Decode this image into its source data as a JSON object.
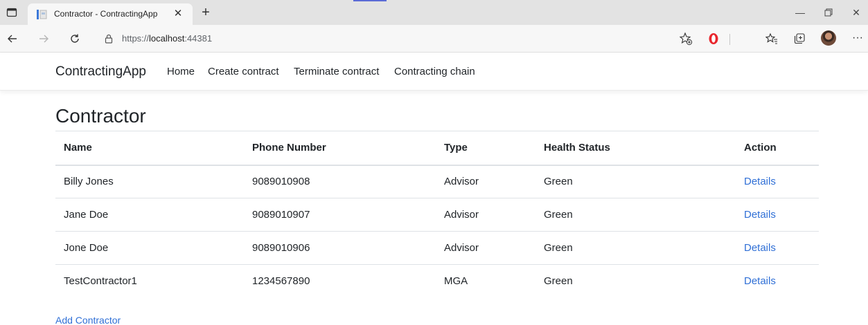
{
  "browser": {
    "tab_title": "Contractor - ContractingApp",
    "url_prefix": "https://",
    "url_host": "localhost",
    "url_port": ":44381"
  },
  "icons": {
    "tab_actions": "tab-actions-icon",
    "favicon": "page-favicon-icon",
    "close": "close-icon",
    "new_tab": "plus-icon",
    "back": "back-arrow-icon",
    "forward": "forward-arrow-icon",
    "refresh": "refresh-icon",
    "lock": "lock-icon",
    "add_favorite": "star-plus-icon",
    "opera": "opera-icon",
    "favorites": "favorites-icon",
    "collections": "collections-icon",
    "profile": "profile-avatar",
    "more": "ellipsis-icon"
  },
  "colors": {
    "link": "#2f6fd6",
    "text": "#212529",
    "tabstrip": "#e3e3e3",
    "opera_red": "#e8262d"
  },
  "navbar": {
    "brand": "ContractingApp",
    "links": [
      "Home",
      "Create contract",
      "Terminate contract",
      "Contracting chain"
    ]
  },
  "page": {
    "title": "Contractor",
    "table": {
      "headers": [
        "Name",
        "Phone Number",
        "Type",
        "Health Status",
        "Action"
      ],
      "rows": [
        {
          "name": "Billy Jones",
          "phone": "9089010908",
          "type": "Advisor",
          "health": "Green",
          "action": "Details"
        },
        {
          "name": "Jane Doe",
          "phone": "9089010907",
          "type": "Advisor",
          "health": "Green",
          "action": "Details"
        },
        {
          "name": "Jone Doe",
          "phone": "9089010906",
          "type": "Advisor",
          "health": "Green",
          "action": "Details"
        },
        {
          "name": "TestContractor1",
          "phone": "1234567890",
          "type": "MGA",
          "health": "Green",
          "action": "Details"
        }
      ]
    },
    "add_link": "Add Contractor"
  }
}
